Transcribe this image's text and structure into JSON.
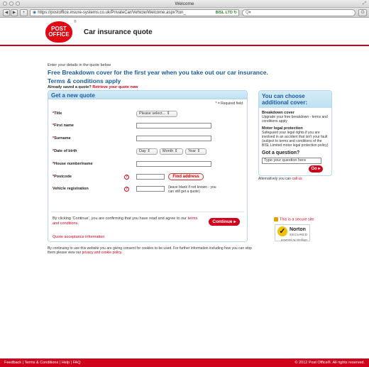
{
  "window": {
    "title": "Welcome"
  },
  "browser": {
    "back": "◀",
    "forward": "▶",
    "add": "+",
    "url": "https://postoffice.insure-systems.co.uk/PrivateCar/Vehicle/Welcome.aspx?ton_",
    "security_label": "BISL LTD",
    "reload": "↻",
    "search_placeholder": "Q▾"
  },
  "header": {
    "logo_line1": "POST",
    "logo_line2": "OFFICE",
    "reg": "®",
    "title": "Car insurance quote"
  },
  "intro": {
    "enter": "Enter your details in the quote below",
    "headline1": "Free Breakdown cover for the first year when you take out our car insurance.",
    "headline2": "Terms & conditions apply",
    "saved_prefix": "Already saved a quote?",
    "saved_link": "Retrieve your quote now"
  },
  "form": {
    "heading": "Get a new quote",
    "required_note": "* = Required field",
    "labels": {
      "title": "Title",
      "first_name": "First name",
      "surname": "Surname",
      "dob": "Date of birth",
      "house": "House number/name",
      "postcode": "Postcode",
      "vehicle": "Vehicle registration"
    },
    "asterisk": "*",
    "title_select": "Please select...",
    "dob_day": "Day",
    "dob_month": "Month",
    "dob_year": "Year",
    "find_address": "Find address",
    "vehicle_note": "(leave blank if not known - you can still get a quote)",
    "confirm_text": "By clicking 'Continue', you are confirming that you have read and agree to our",
    "confirm_link": "terms and conditions",
    "continue": "Continue",
    "quote_info": "Quote acceptance information"
  },
  "cookie": {
    "text": "By continuing to use this website you are giving consent for cookies to be used. For further information including how you can stop them please view our",
    "link": "privacy and cookie policy"
  },
  "side": {
    "heading": "You can choose additional cover:",
    "breakdown_title": "Breakdown cover",
    "breakdown_text": "Upgrade your free breakdown - terms and conditions apply",
    "legal_title": "Motor legal protection",
    "legal_text": "Safeguard your legal rights if you are involved in an accident that isn't your fault (subject to terms and conditions of the BISL Limited motor legal protection policy)",
    "question_title": "Got a question?",
    "question_placeholder": "Type your question here",
    "go": "Go",
    "alt_prefix": "Alternatively you can",
    "alt_link": "call us",
    "secure": "This is a secure site",
    "norton_name": "Norton",
    "norton_secured": "SECURED",
    "norton_by": "powered by VeriSign"
  },
  "footer": {
    "links": "Feedback | Terms & Conditions | Help | FAQ",
    "copyright": "© 2012 Post Office®. All rights reserved."
  }
}
